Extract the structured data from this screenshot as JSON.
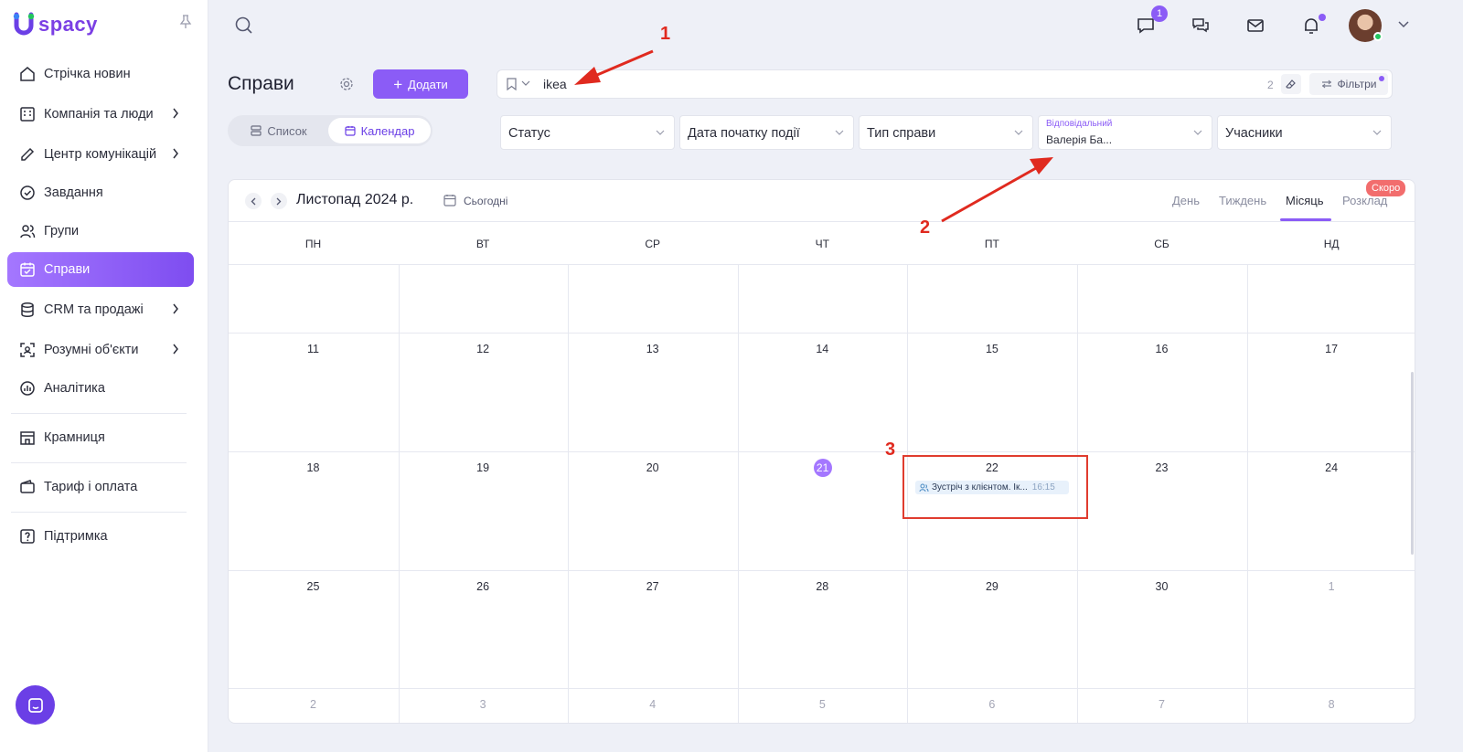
{
  "app": {
    "logo_text": "spacy"
  },
  "sidebar": {
    "items": [
      {
        "label": "Стрічка новин",
        "icon": "home-icon"
      },
      {
        "label": "Компанія та люди",
        "icon": "building-icon"
      },
      {
        "label": "Центр комунікацій",
        "icon": "edit-icon"
      },
      {
        "label": "Завдання",
        "icon": "check-circle-icon"
      },
      {
        "label": "Групи",
        "icon": "users-icon"
      },
      {
        "label": "Справи",
        "icon": "calendar-check-icon"
      },
      {
        "label": "CRM та продажі",
        "icon": "database-icon"
      },
      {
        "label": "Розумні об'єкти",
        "icon": "scan-icon"
      },
      {
        "label": "Аналітика",
        "icon": "chart-icon"
      },
      {
        "label": "Крамниця",
        "icon": "store-icon"
      },
      {
        "label": "Тариф і оплата",
        "icon": "wallet-icon"
      },
      {
        "label": "Підтримка",
        "icon": "help-icon"
      }
    ]
  },
  "topbar": {
    "chat_badge": "1"
  },
  "header": {
    "title": "Справи",
    "add_label": "Додати",
    "view_list": "Список",
    "view_calendar": "Календар"
  },
  "search": {
    "value": "ikea",
    "count": "2",
    "filters_label": "Фільтри"
  },
  "filters": {
    "status": "Статус",
    "start_date": "Дата початку події",
    "type": "Тип справи",
    "responsible_label": "Відповідальний",
    "responsible_value": "Валерія Ба...",
    "participants": "Учасники"
  },
  "calendar": {
    "title": "Листопад 2024 р.",
    "today": "Сьогодні",
    "views": [
      "День",
      "Тиждень",
      "Місяць",
      "Розклад"
    ],
    "soon": "Скоро",
    "weekdays": [
      "ПН",
      "ВТ",
      "СР",
      "ЧТ",
      "ПТ",
      "СБ",
      "НД"
    ],
    "weeks": [
      [
        "",
        "",
        "",
        "",
        "",
        "",
        ""
      ],
      [
        "11",
        "12",
        "13",
        "14",
        "15",
        "16",
        "17"
      ],
      [
        "18",
        "19",
        "20",
        "21",
        "22",
        "23",
        "24"
      ],
      [
        "25",
        "26",
        "27",
        "28",
        "29",
        "30",
        "1"
      ],
      [
        "2",
        "3",
        "4",
        "5",
        "6",
        "7",
        "8"
      ]
    ],
    "event": {
      "title": "Зустріч з клієнтом. Ік...",
      "time": "16:15"
    }
  },
  "annotations": [
    "1",
    "2",
    "3"
  ],
  "colors": {
    "accent": "#8b5cf6",
    "annotation": "#e02a1f"
  }
}
